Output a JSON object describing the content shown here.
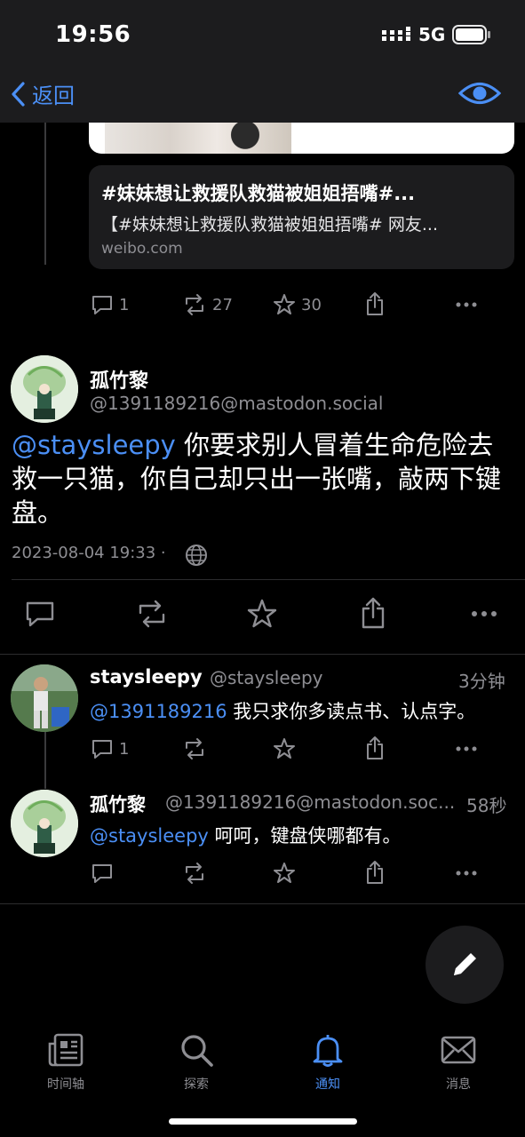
{
  "status": {
    "time": "19:56",
    "network": "5G"
  },
  "nav": {
    "back_label": "返回"
  },
  "prev_post": {
    "link_title": "#妹妹想让救援队救猫被姐姐捂嘴#...",
    "link_desc": "【#妹妹想让救援队救猫被姐姐捂嘴# 网友...",
    "link_domain": "weibo.com",
    "replies": "1",
    "boosts": "27",
    "favs": "30"
  },
  "main_post": {
    "name": "孤竹黎",
    "handle": "@1391189216@mastodon.social",
    "mention": "@staysleepy",
    "text": " 你要求别人冒着生命危险去救一只猫，你自己却只出一张嘴，敲两下键盘。",
    "date": "2023-08-04 19:33 ·"
  },
  "replies": [
    {
      "name": "staysleepy",
      "handle": "@staysleepy",
      "time": "3分钟",
      "mention": "@1391189216",
      "text": " 我只求你多读点书、认点字。",
      "reply_count": "1"
    },
    {
      "name": "孤竹黎",
      "handle": "@1391189216@mastodon.soc...",
      "time": "58秒",
      "mention": "@staysleepy",
      "text": " 呵呵，键盘侠哪都有。",
      "reply_count": ""
    }
  ],
  "tabs": [
    {
      "label": "时间轴",
      "icon": "newspaper-icon"
    },
    {
      "label": "探索",
      "icon": "search-icon"
    },
    {
      "label": "通知",
      "icon": "bell-icon"
    },
    {
      "label": "消息",
      "icon": "envelope-icon"
    }
  ],
  "colors": {
    "accent": "#4b8ff5",
    "muted": "#8e8e93",
    "background": "#000000",
    "card": "#1c1c1e"
  }
}
